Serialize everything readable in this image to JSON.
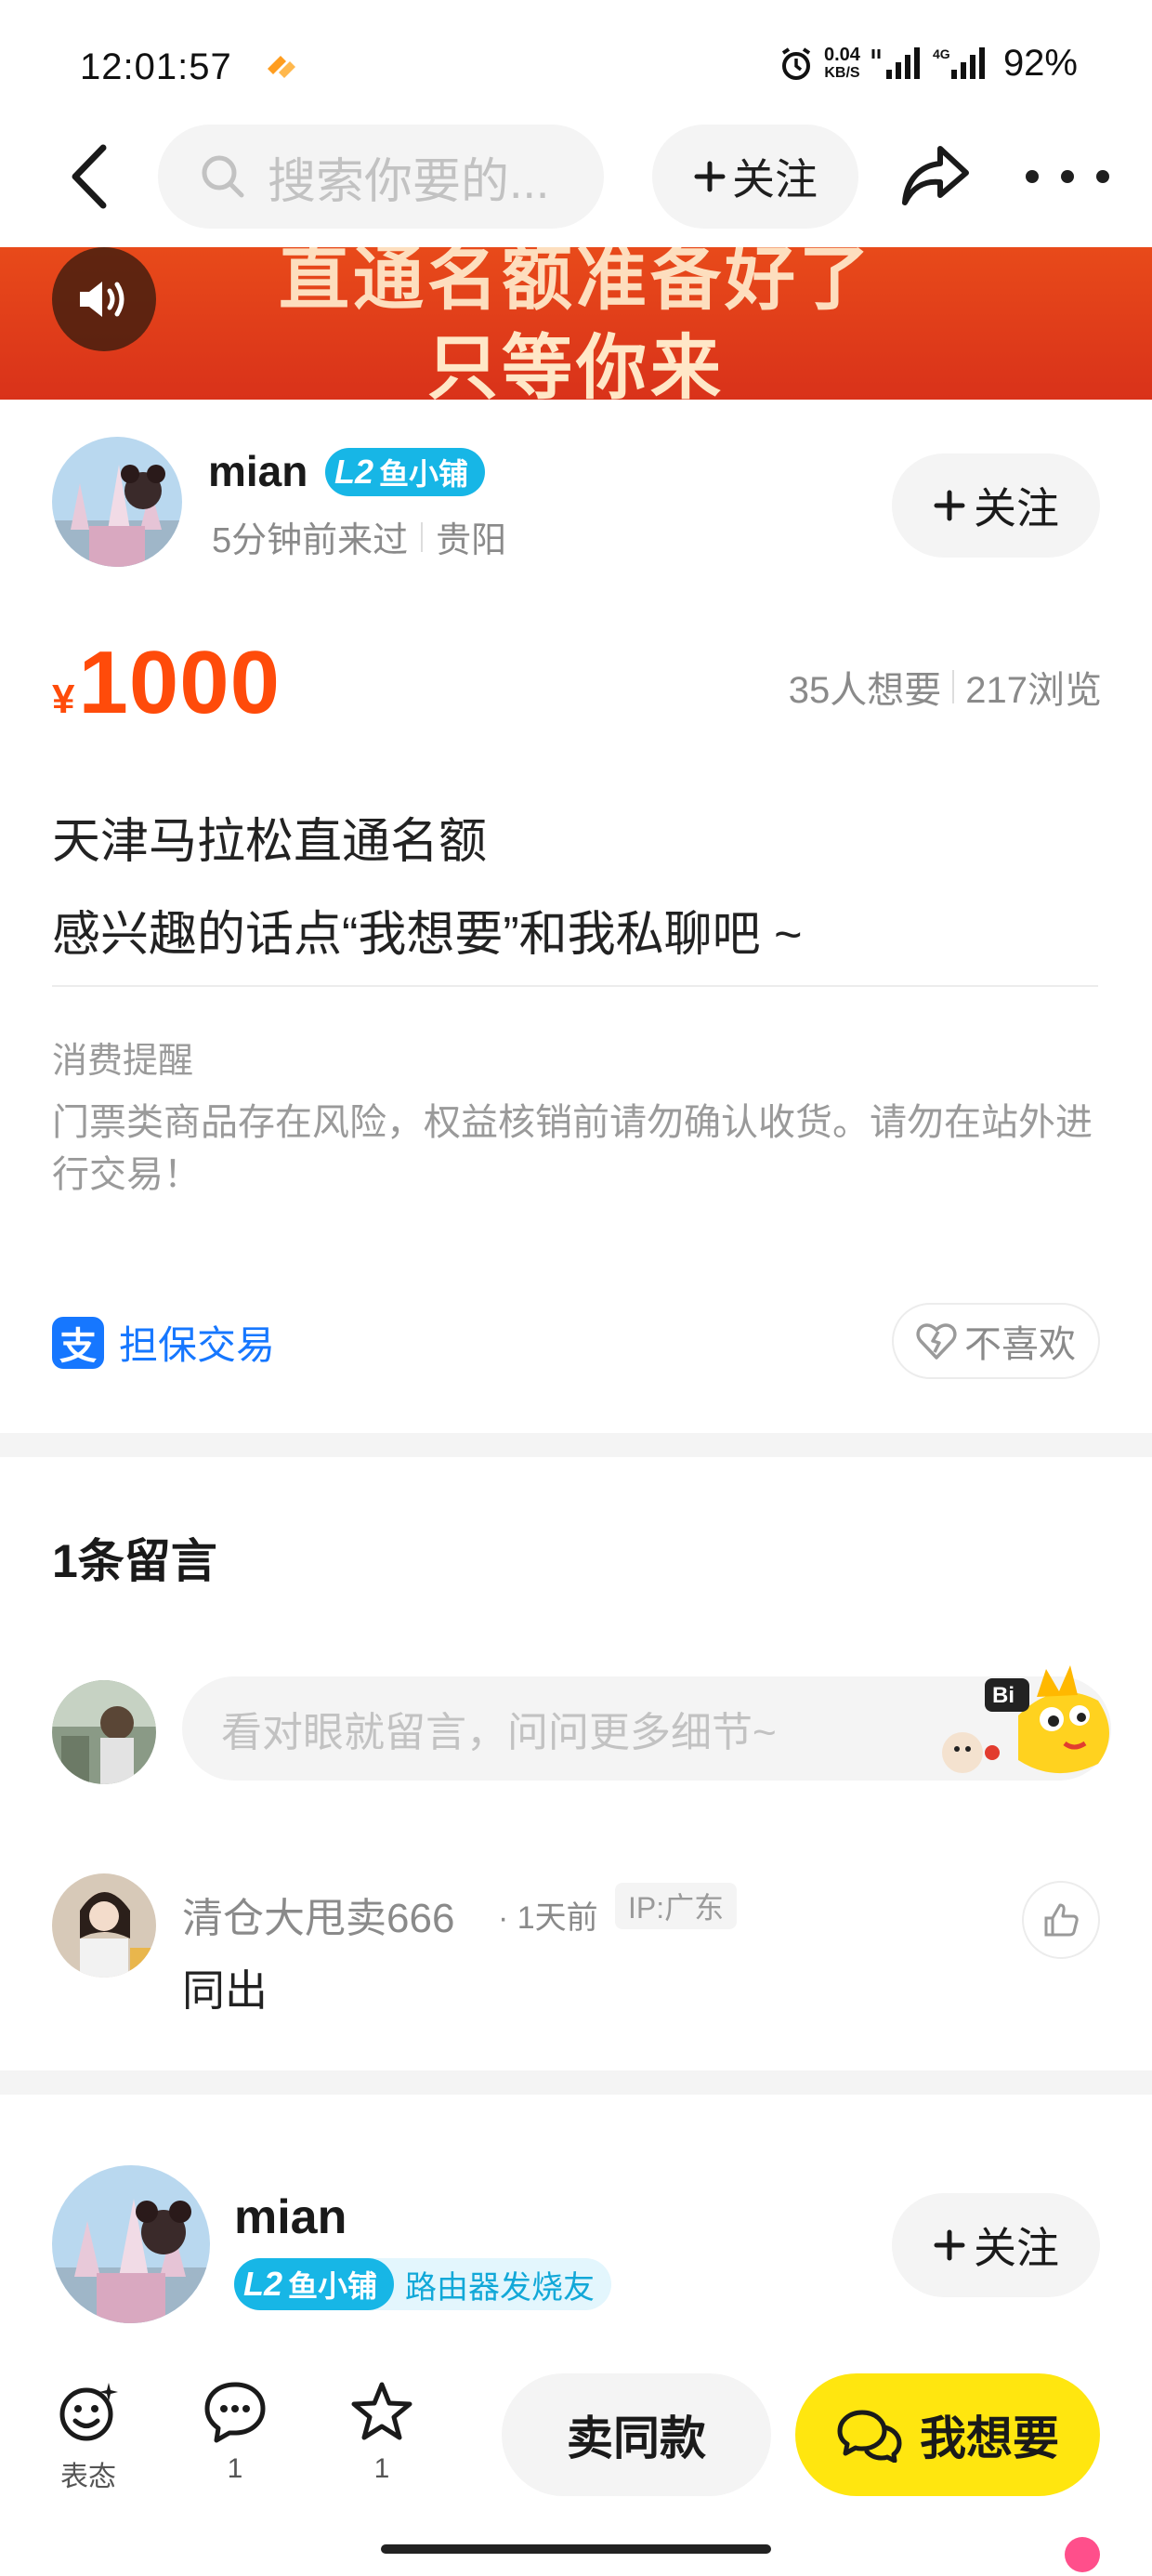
{
  "status": {
    "time": "12:01:57",
    "speed_value": "0.04",
    "speed_unit": "KB/S",
    "network": "4G",
    "battery": "92%"
  },
  "nav": {
    "search_placeholder": "搜索你要的...",
    "follow_label": "关注"
  },
  "banner": {
    "line1": "直通名额准备好了",
    "line2": "只等你来"
  },
  "seller": {
    "name": "mian",
    "level": "L2",
    "shop": "鱼小铺",
    "last_seen": "5分钟前来过",
    "location": "贵阳",
    "follow_label": "关注"
  },
  "item": {
    "currency": "¥",
    "price": "1000",
    "wants": "35人想要",
    "views": "217浏览",
    "title": "天津马拉松直通名额",
    "subtitle": "感兴趣的话点“我想要”和我私聊吧 ~"
  },
  "notice": {
    "title": "消费提醒",
    "body": "门票类商品存在风险，权益核销前请勿确认收货。请勿在站外进行交易！"
  },
  "trade": {
    "guarantee": "担保交易",
    "dislike": "不喜欢"
  },
  "comments": {
    "title": "1条留言",
    "input_placeholder": "看对眼就留言，问问更多细节~",
    "items": [
      {
        "user": "清仓大甩卖666",
        "time": "· 1天前",
        "ip": "IP:广东",
        "text": "同出"
      }
    ]
  },
  "seller_card": {
    "name": "mian",
    "level": "L2",
    "shop": "鱼小铺",
    "tag": "路由器发烧友",
    "follow_label": "关注"
  },
  "bottom": {
    "react_label": "表态",
    "comment_count": "1",
    "fav_count": "1",
    "sell_same": "卖同款",
    "want": "我想要"
  },
  "colors": {
    "price": "#ff4b0a",
    "accent_yellow": "#ffe60f",
    "badge_blue": "#17b6e6",
    "alipay_blue": "#1677ff",
    "banner": "#e0391a"
  }
}
